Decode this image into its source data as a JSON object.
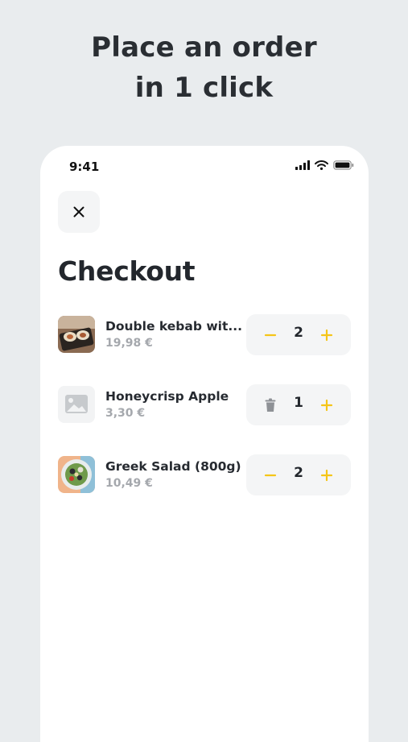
{
  "headline": {
    "line1": "Place an order",
    "line2": "in 1 click"
  },
  "status_bar": {
    "time": "9:41",
    "icons": [
      "signal-icon",
      "wifi-icon",
      "battery-icon"
    ]
  },
  "header": {
    "close_icon": "close-icon",
    "title": "Checkout"
  },
  "colors": {
    "accent": "#f5c518",
    "background": "#e9ecee",
    "surface": "#f4f5f6",
    "text": "#23272d",
    "muted": "#a5a8ad"
  },
  "cart": {
    "items": [
      {
        "name": "Double kebab wit...",
        "price": "19,98 €",
        "quantity": "2",
        "decrement": "minus-icon",
        "image": "kebab-photo"
      },
      {
        "name": "Honeycrisp Apple",
        "price": "3,30 €",
        "quantity": "1",
        "decrement": "trash-icon",
        "image": "image-placeholder-icon"
      },
      {
        "name": "Greek Salad (800g)",
        "price": "10,49 €",
        "quantity": "2",
        "decrement": "minus-icon",
        "image": "salad-photo"
      }
    ]
  }
}
